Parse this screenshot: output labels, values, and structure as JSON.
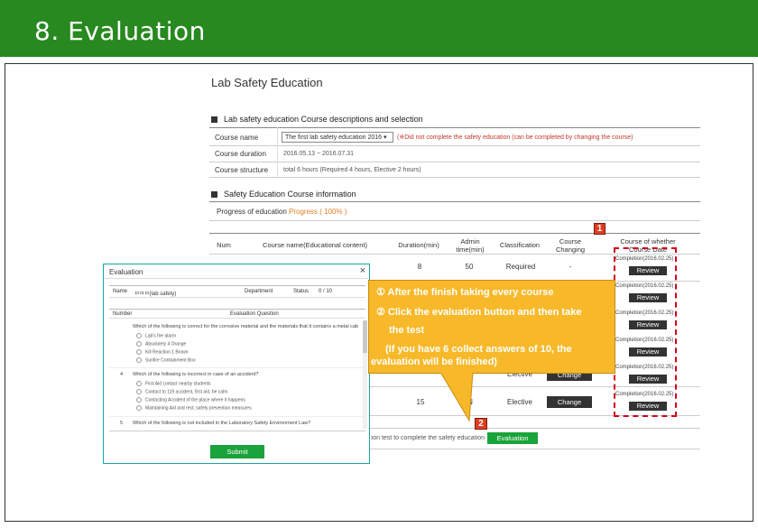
{
  "slide_title": "8. Evaluation",
  "page": {
    "title": "Lab Safety Education",
    "section1_title": "Lab safety education Course descriptions and selection",
    "course_name_label": "Course name",
    "course_name_value": "The first lab safety education 2016",
    "course_name_note": "(※Did not complete the safety education (can be completed by changing the course)",
    "duration_label": "Course duration",
    "duration_value": "2016.05.13 ~ 2016.07.31",
    "structure_label": "Course structure",
    "structure_value": "total 6 hours (Required 4 hours, Elective 2 hours)",
    "section2_title": "Safety Education Course information",
    "progress_label": "Progress of education :",
    "progress_value": "Progress ( 100% )",
    "table_headers": [
      "Num",
      "Course name(Educational content)",
      "Duration(min)",
      "Admin time(min)",
      "Classification",
      "Course Changing",
      "Course of whether Course Date"
    ],
    "row1": {
      "duration": "8",
      "admin": "50",
      "classification": "Required",
      "changing": "-"
    },
    "row5": {
      "duration": "15",
      "admin": "N",
      "classification": "Elective",
      "changing": "Change"
    },
    "row4_classification": "Elective",
    "row4_changing": "Change",
    "completion_date": "Completion(2016.02.25)",
    "review_label": "Review",
    "footer_text": "Please do the evaluation test to complete the safety education.",
    "evaluation_button": "Evaluation"
  },
  "modal": {
    "title": "Evaluation",
    "name_label": "Name",
    "name_value": "ㅁㅁㅁ(lab safety)",
    "department_label": "Department",
    "status_label": "Status",
    "status_value": "0 / 10",
    "col_number": "Number",
    "col_questions": "Evaluation Question",
    "q1": "Which of the following is correct for the corrosive material and the materials that it contains a metal cabinet?",
    "q1_options": [
      "Lab's fire alarm",
      "Absolutely 4 Orange",
      "Kill Reaction 1 Brown",
      "Sunfire Containment Box"
    ],
    "q4_num": "4",
    "q4": "Which of the following is incorrect in case of an accident?",
    "q4_options": [
      "First Aid contact nearby students",
      "Contact to 119 accident, first aid, be calm",
      "Contacting Accident of the place where it happens",
      "Maintaining Aid and rest, safety prevention measures"
    ],
    "q5_num": "5",
    "q5": "Which of the following is not included in the Laboratory Safety Environment Law?",
    "submit_label": "Submit"
  },
  "badges": {
    "b1": "1",
    "b2": "2"
  },
  "callout": {
    "line1": "① After the finish taking every course",
    "line2": "② Click the evaluation button and then take",
    "line3": "the test",
    "line4": "(If you have 6 collect answers of 10, the",
    "line5": "evaluation will be finished)"
  },
  "colors": {
    "header_green": "#27891f",
    "callout": "#f7b92a",
    "badge_red": "#e03c22",
    "button_green": "#1aa33a"
  }
}
